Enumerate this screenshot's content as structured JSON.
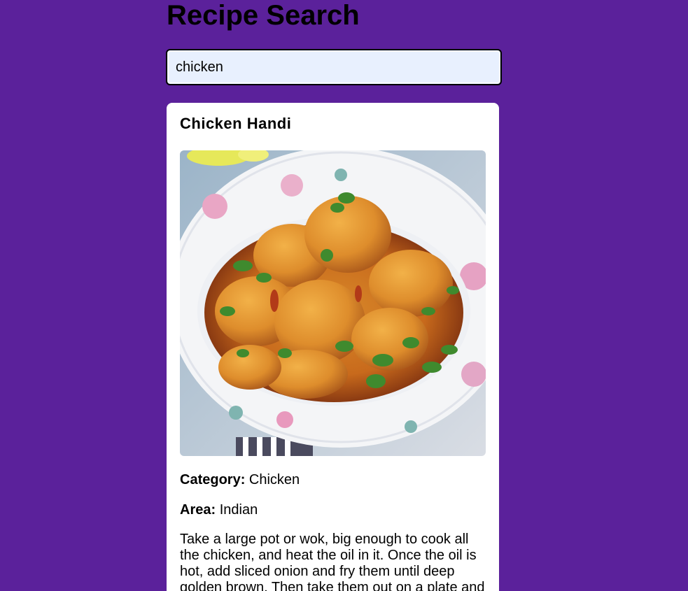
{
  "header": {
    "title": "Recipe Search"
  },
  "search": {
    "value": "chicken"
  },
  "recipe": {
    "name": "Chicken Handi",
    "category_label": "Category:",
    "category": "Chicken",
    "area_label": "Area:",
    "area": "Indian",
    "instructions": "Take a large pot or wok, big enough to cook all the chicken, and heat the oil in it. Once the oil is hot, add sliced onion and fry them until deep golden brown. Then take them out on a plate and set aside."
  },
  "colors": {
    "background": "#5b219b",
    "card": "#ffffff",
    "input_fill": "#e8f0fe"
  }
}
